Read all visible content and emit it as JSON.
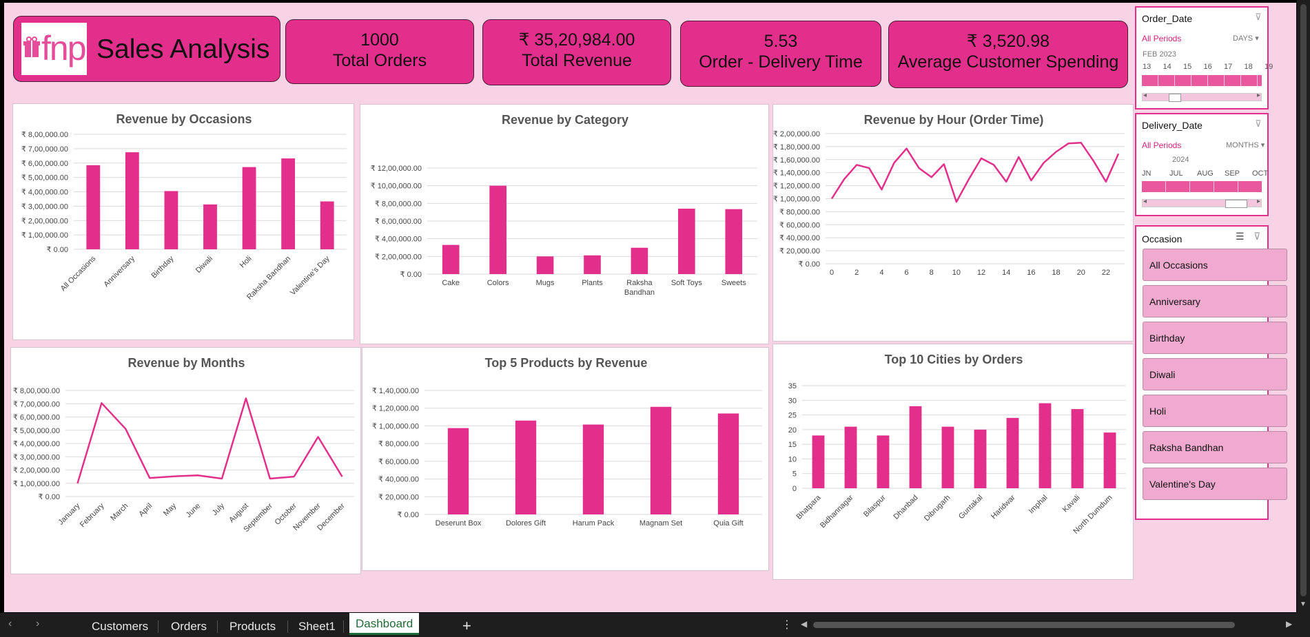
{
  "header": {
    "logo_text": "fnp",
    "title": "Sales Analysis"
  },
  "kpis": [
    {
      "value": "1000",
      "label": "Total Orders"
    },
    {
      "value": "₹ 35,20,984.00",
      "label": "Total Revenue"
    },
    {
      "value": "5.53",
      "label": "Order - Delivery Time"
    },
    {
      "value": "₹ 3,520.98",
      "label": "Average Customer Spending"
    }
  ],
  "colors": {
    "accent": "#e22f8c",
    "background": "#f8d3e6",
    "slicer_item": "#f0a9cf"
  },
  "slicers": {
    "order_date": {
      "title": "Order_Date",
      "period": "All Periods",
      "level": "DAYS",
      "group_label": "FEB 2023",
      "ticks": [
        "13",
        "14",
        "15",
        "16",
        "17",
        "18",
        "19"
      ]
    },
    "delivery_date": {
      "title": "Delivery_Date",
      "period": "All Periods",
      "level": "MONTHS",
      "group_label": "2024",
      "ticks": [
        "JN",
        "JUL",
        "AUG",
        "SEP",
        "OCT"
      ]
    },
    "occasion": {
      "title": "Occasion",
      "items": [
        "All Occasions",
        "Anniversary",
        "Birthday",
        "Diwali",
        "Holi",
        "Raksha Bandhan",
        "Valentine's Day"
      ]
    }
  },
  "tabs": {
    "items": [
      "Customers",
      "Orders",
      "Products",
      "Sheet1"
    ],
    "active": "Dashboard",
    "add": "+"
  },
  "chart_data": [
    {
      "id": "occasions",
      "type": "bar",
      "title": "Revenue by Occasions",
      "categories": [
        "All Occasions",
        "Anniversary",
        "Birthday",
        "Diwali",
        "Holi",
        "Raksha Bandhan",
        "Valentine's Day"
      ],
      "values": [
        585000,
        675000,
        405000,
        312000,
        572000,
        632000,
        333000
      ],
      "ylim": [
        0,
        800000
      ],
      "ytick_labels": [
        "₹ 0.00",
        "₹ 1,00,000.00",
        "₹ 2,00,000.00",
        "₹ 3,00,000.00",
        "₹ 4,00,000.00",
        "₹ 5,00,000.00",
        "₹ 6,00,000.00",
        "₹ 7,00,000.00",
        "₹ 8,00,000.00"
      ],
      "grid": true
    },
    {
      "id": "category",
      "type": "bar",
      "title": "Revenue by Category",
      "categories": [
        "Cake",
        "Colors",
        "Mugs",
        "Plants",
        "Raksha Bandhan",
        "Soft Toys",
        "Sweets"
      ],
      "values": [
        330000,
        1000000,
        200000,
        212000,
        298000,
        740000,
        735000
      ],
      "ylim": [
        0,
        1200000
      ],
      "ytick_labels": [
        "₹ 0.00",
        "₹ 2,00,000.00",
        "₹ 4,00,000.00",
        "₹ 6,00,000.00",
        "₹ 8,00,000.00",
        "₹ 10,00,000.00",
        "₹ 12,00,000.00"
      ],
      "grid": true
    },
    {
      "id": "hour",
      "type": "line",
      "title": "Revenue by Hour (Order Time)",
      "x": [
        0,
        1,
        2,
        3,
        4,
        5,
        6,
        7,
        8,
        9,
        10,
        11,
        12,
        13,
        14,
        15,
        16,
        17,
        18,
        19,
        20,
        21,
        22,
        23
      ],
      "values": [
        100000,
        130000,
        152000,
        147000,
        114000,
        155000,
        177000,
        147000,
        133000,
        153000,
        95000,
        130000,
        162000,
        152000,
        126000,
        164000,
        128000,
        155000,
        172000,
        185000,
        186000,
        158000,
        126000,
        169000
      ],
      "ylim": [
        0,
        200000
      ],
      "xtick_labels": [
        "0",
        "2",
        "4",
        "6",
        "8",
        "10",
        "12",
        "14",
        "16",
        "18",
        "20",
        "22"
      ],
      "ytick_labels": [
        "₹ 0.00",
        "₹ 20,000.00",
        "₹ 40,000.00",
        "₹ 60,000.00",
        "₹ 80,000.00",
        "₹ 1,00,000.00",
        "₹ 1,20,000.00",
        "₹ 1,40,000.00",
        "₹ 1,60,000.00",
        "₹ 1,80,000.00",
        "₹ 2,00,000.00"
      ],
      "grid": true
    },
    {
      "id": "months",
      "type": "line",
      "title": "Revenue by Months",
      "categories": [
        "January",
        "February",
        "March",
        "April",
        "May",
        "June",
        "July",
        "August",
        "September",
        "October",
        "November",
        "December"
      ],
      "values": [
        100000,
        705000,
        510000,
        140000,
        152000,
        160000,
        135000,
        740000,
        135000,
        150000,
        450000,
        150000
      ],
      "ylim": [
        0,
        800000
      ],
      "ytick_labels": [
        "₹ 0.00",
        "₹ 1,00,000.00",
        "₹ 2,00,000.00",
        "₹ 3,00,000.00",
        "₹ 4,00,000.00",
        "₹ 5,00,000.00",
        "₹ 6,00,000.00",
        "₹ 7,00,000.00",
        "₹ 8,00,000.00"
      ],
      "grid": true
    },
    {
      "id": "products",
      "type": "bar",
      "title": "Top 5 Products by Revenue",
      "categories": [
        "Deserunt Box",
        "Dolores Gift",
        "Harum Pack",
        "Magnam Set",
        "Quia Gift"
      ],
      "values": [
        97500,
        106000,
        101500,
        121500,
        114000
      ],
      "ylim": [
        0,
        140000
      ],
      "ytick_labels": [
        "₹ 0.00",
        "₹ 20,000.00",
        "₹ 40,000.00",
        "₹ 60,000.00",
        "₹ 80,000.00",
        "₹ 1,00,000.00",
        "₹ 1,20,000.00",
        "₹ 1,40,000.00"
      ],
      "grid": true
    },
    {
      "id": "cities",
      "type": "bar",
      "title": "Top 10 Cities by Orders",
      "categories": [
        "Bhatpara",
        "Bidhannagar",
        "Bilaspur",
        "Dhanbad",
        "Dibrugarh",
        "Guntakal",
        "Haridwar",
        "Imphal",
        "Kavali",
        "North Dumdum"
      ],
      "values": [
        18,
        21,
        18,
        28,
        21,
        20,
        24,
        29,
        27,
        19
      ],
      "ylim": [
        0,
        35
      ],
      "ytick_labels": [
        "0",
        "5",
        "10",
        "15",
        "20",
        "25",
        "30",
        "35"
      ],
      "grid": true
    }
  ]
}
